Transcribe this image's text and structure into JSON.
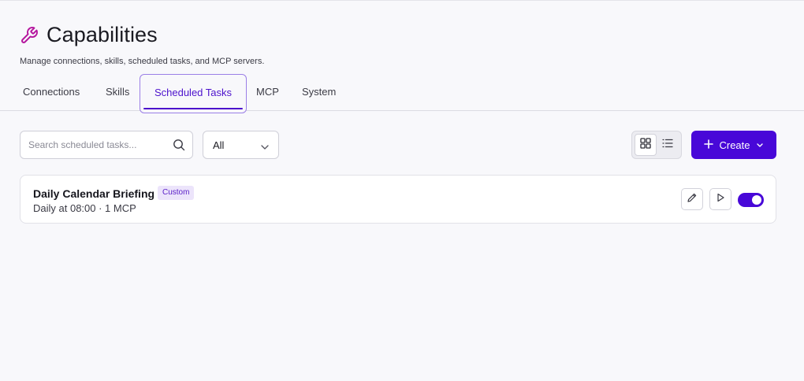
{
  "header": {
    "icon": "wrench-icon",
    "title": "Capabilities",
    "subtitle": "Manage connections, skills, scheduled tasks, and MCP servers."
  },
  "tabs": [
    {
      "label": "Connections",
      "active": false
    },
    {
      "label": "Skills",
      "active": false
    },
    {
      "label": "Scheduled Tasks",
      "active": true
    },
    {
      "label": "MCP",
      "active": false
    },
    {
      "label": "System",
      "active": false
    }
  ],
  "toolbar": {
    "search_placeholder": "Search scheduled tasks...",
    "search_value": "",
    "filter_value": "All",
    "view_mode": "grid",
    "create_label": "Create"
  },
  "tasks": [
    {
      "title": "Daily Calendar Briefing",
      "badge": "Custom",
      "schedule": "Daily at 08:00 · 1 MCP",
      "enabled": true
    }
  ],
  "colors": {
    "accent": "#4808d8",
    "accent_text": "#4c12cc",
    "brand_icon": "#b5179e",
    "badge_bg": "#ece4fb",
    "background": "#f8f8fb"
  }
}
